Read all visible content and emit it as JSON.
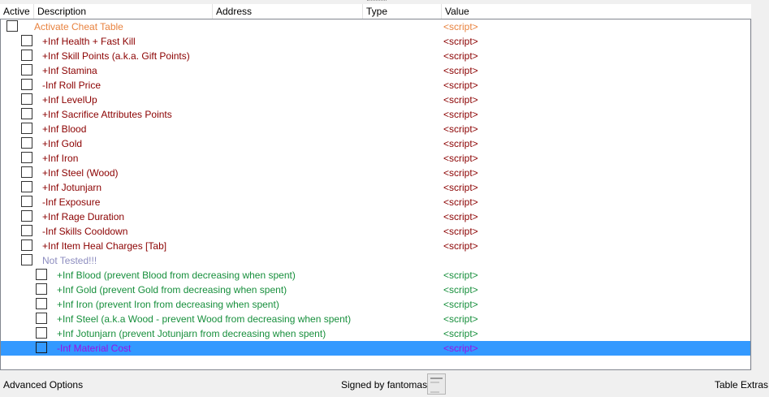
{
  "columns": {
    "active": "Active",
    "description": "Description",
    "address": "Address",
    "type": "Type",
    "value": "Value"
  },
  "rows": [
    {
      "description": "Activate Cheat Table",
      "value": "<script>"
    },
    {
      "description": "+Inf Health + Fast Kill",
      "value": "<script>"
    },
    {
      "description": "+Inf Skill Points (a.k.a. Gift Points)",
      "value": "<script>"
    },
    {
      "description": "+Inf Stamina",
      "value": "<script>"
    },
    {
      "description": "-Inf Roll Price",
      "value": "<script>"
    },
    {
      "description": "+Inf LevelUp",
      "value": "<script>"
    },
    {
      "description": "+Inf Sacrifice Attributes Points",
      "value": "<script>"
    },
    {
      "description": "+Inf Blood",
      "value": "<script>"
    },
    {
      "description": "+Inf Gold",
      "value": "<script>"
    },
    {
      "description": "+Inf Iron",
      "value": "<script>"
    },
    {
      "description": "+Inf Steel (Wood)",
      "value": "<script>"
    },
    {
      "description": "+Inf Jotunjarn",
      "value": "<script>"
    },
    {
      "description": "-Inf Exposure",
      "value": "<script>"
    },
    {
      "description": "+Inf Rage Duration",
      "value": "<script>"
    },
    {
      "description": "-Inf Skills Cooldown",
      "value": "<script>"
    },
    {
      "description": "+Inf Item Heal Charges [Tab]",
      "value": "<script>"
    },
    {
      "description": "Not Tested!!!",
      "value": ""
    },
    {
      "description": "+Inf Blood (prevent Blood from decreasing when spent)",
      "value": "<script>"
    },
    {
      "description": "+Inf Gold (prevent Gold from decreasing when spent)",
      "value": "<script>"
    },
    {
      "description": "+Inf Iron (prevent Iron from decreasing when spent)",
      "value": "<script>"
    },
    {
      "description": "+Inf Steel (a.k.a Wood - prevent Wood from decreasing when spent)",
      "value": "<script>"
    },
    {
      "description": "+Inf Jotunjarn (prevent Jotunjarn from decreasing when spent)",
      "value": "<script>"
    },
    {
      "description": "-Inf Material Cost",
      "value": "<script>"
    }
  ],
  "footer": {
    "advanced_options": "Advanced Options",
    "signed_by": "Signed by fantomas",
    "table_extras": "Table Extras"
  },
  "colors": {
    "header_entry": "#e8823e",
    "cheat_entry": "#8b0000",
    "group_entry": "#8c8cbf",
    "child_entry": "#178f3c",
    "selected_entry": "#9a10e8",
    "selection_background": "#3399ff"
  },
  "icons": {
    "signature": "certificate-icon"
  }
}
